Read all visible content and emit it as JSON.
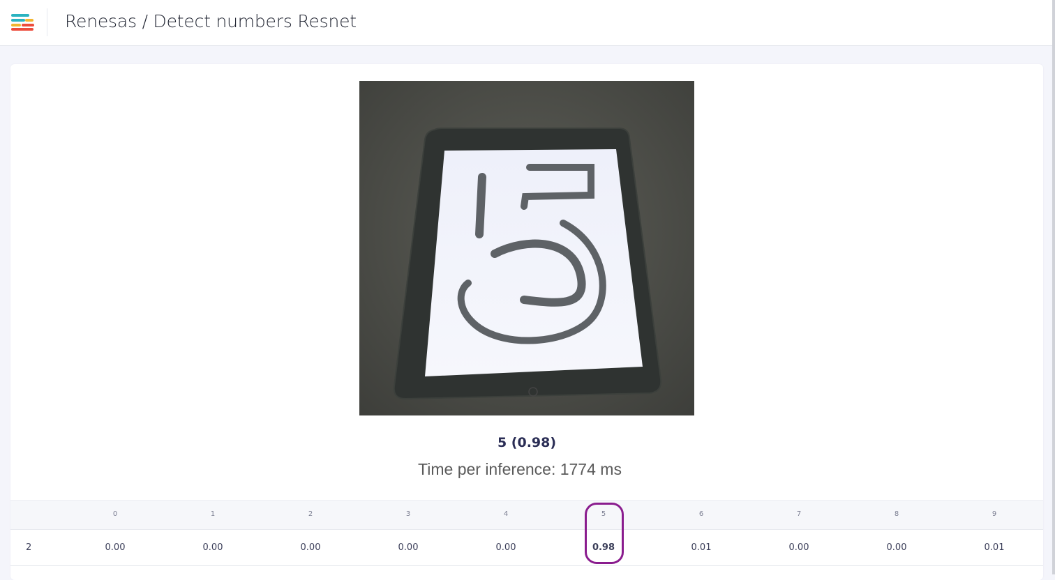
{
  "header": {
    "title": "Renesas / Detect numbers Resnet"
  },
  "result": {
    "prediction": "5 (0.98)",
    "timing": "Time per inference: 1774 ms",
    "image_digit": "5"
  },
  "table": {
    "columns": [
      "0",
      "1",
      "2",
      "3",
      "4",
      "5",
      "6",
      "7",
      "8",
      "9"
    ],
    "rows": [
      {
        "label": "2",
        "values": [
          "0.00",
          "0.00",
          "0.00",
          "0.00",
          "0.00",
          "0.98",
          "0.01",
          "0.00",
          "0.00",
          "0.01"
        ]
      }
    ],
    "highlighted_column": "5"
  },
  "colors": {
    "highlight": "#8a1c8e",
    "logo_teal": "#2bb3c0",
    "logo_yellow": "#f2b530",
    "logo_red": "#ec4c3c"
  }
}
